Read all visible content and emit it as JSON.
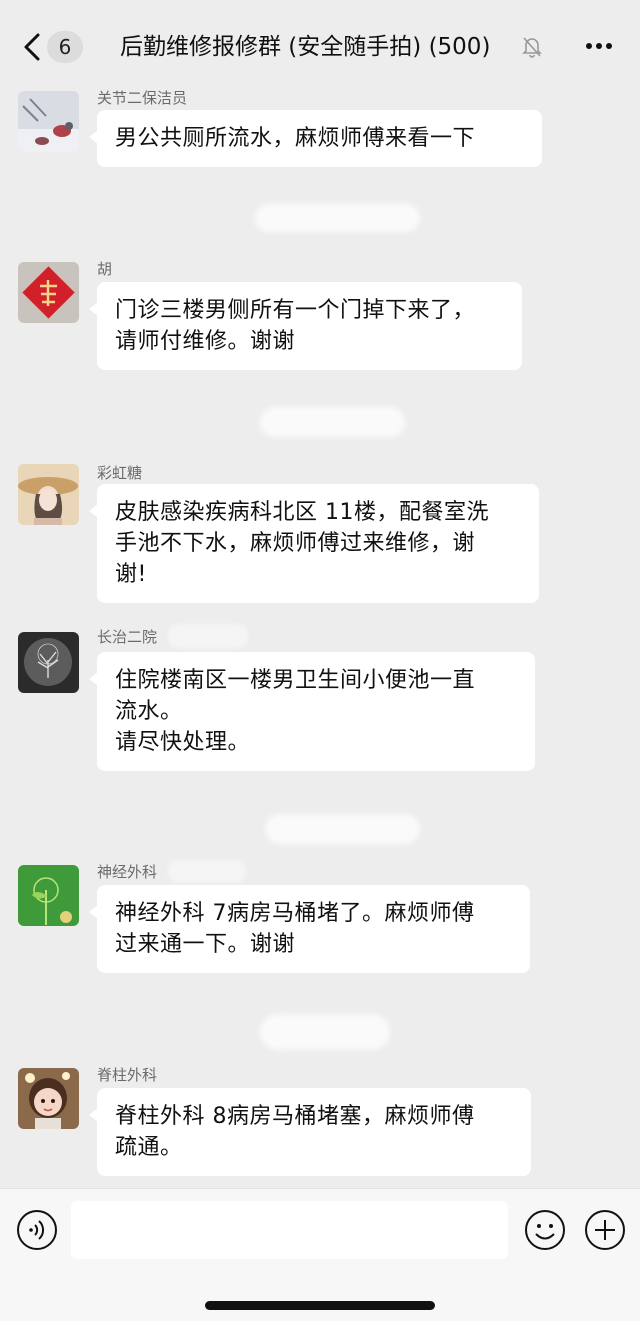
{
  "header": {
    "unread_count": "6",
    "title": "后勤维修报修群 (安全随手拍) (500)"
  },
  "icons": {
    "back": "chevron-left-icon",
    "mute": "bell-muted-icon",
    "more": "more-dots-icon",
    "voice": "voice-icon",
    "emoji": "emoji-icon",
    "plus": "plus-icon"
  },
  "messages": [
    {
      "sender": "关节二保洁员",
      "text": "男公共厕所流水，麻烦师傅来看一下",
      "avatar": "winter-bird-avatar"
    },
    {
      "sender": "胡",
      "text": "门诊三楼男侧所有一个门掉下来了，\n请师付维修。谢谢",
      "avatar": "fu-character-avatar"
    },
    {
      "sender": "彩虹糖",
      "text": "皮肤感染疾病科北区 11楼，配餐室洗\n手池不下水，麻烦师傅过来维修，谢\n谢!",
      "avatar": "girl-hat-avatar"
    },
    {
      "sender": "长治二院",
      "text": "住院楼南区一楼男卫生间小便池一直\n流水。\n请尽快处理。",
      "avatar": "tree-avatar"
    },
    {
      "sender": "神经外科",
      "text": "神经外科 7病房马桶堵了。麻烦师傅\n过来通一下。谢谢",
      "avatar": "green-plant-avatar"
    },
    {
      "sender": "脊柱外科",
      "text": "脊柱外科 8病房马桶堵塞，麻烦师傅\n疏通。",
      "avatar": "cartoon-girl-avatar"
    }
  ],
  "input": {
    "value": ""
  },
  "colors": {
    "background": "#ededed",
    "bubble": "#ffffff",
    "sender_text": "#6b6b6b",
    "input_bar": "#f7f7f7"
  }
}
